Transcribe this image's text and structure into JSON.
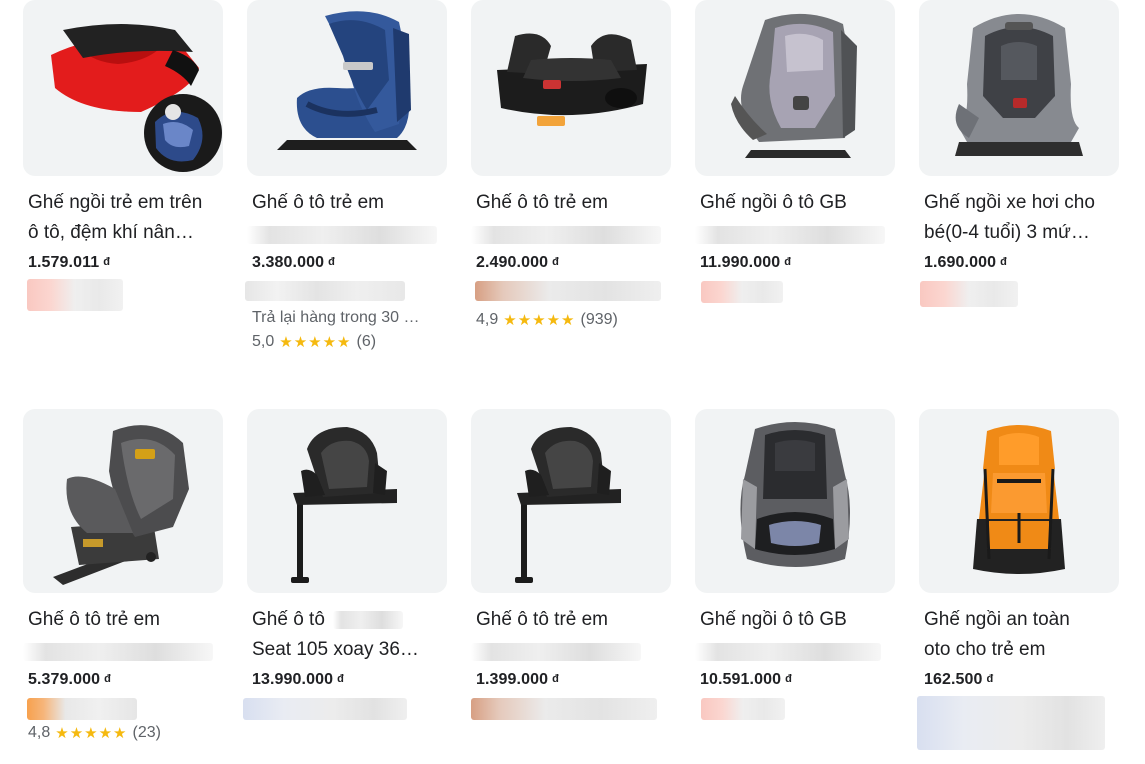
{
  "products": [
    {
      "title_l1": "Ghế ngồi trẻ em trên",
      "title_l2": "ô tô, đệm khí nân…",
      "price": "1.579.011",
      "currency": "đ",
      "extra": "",
      "rating": "",
      "review_count": "",
      "icon": "booster-cushion-image"
    },
    {
      "title_l1": "Ghế ô tô trẻ em",
      "title_l2": "",
      "price": "3.380.000",
      "currency": "đ",
      "extra": "Trả lại hàng trong 30 …",
      "rating": "5,0",
      "review_count": "(6)",
      "icon": "blue-car-seat-image"
    },
    {
      "title_l1": "Ghế ô tô trẻ em",
      "title_l2": "",
      "price": "2.490.000",
      "currency": "đ",
      "extra": "",
      "rating": "4,9",
      "review_count": "(939)",
      "icon": "black-booster-seat-image"
    },
    {
      "title_l1": "Ghế ngồi ô tô GB",
      "title_l2": "",
      "price": "11.990.000",
      "currency": "đ",
      "extra": "",
      "rating": "",
      "review_count": "",
      "icon": "gray-convertible-seat-image"
    },
    {
      "title_l1": "Ghế ngồi xe hơi cho",
      "title_l2": "bé(0-4 tuổi) 3 mứ…",
      "price": "1.690.000",
      "currency": "đ",
      "extra": "",
      "rating": "",
      "review_count": "",
      "icon": "gray-infant-seat-image"
    },
    {
      "title_l1": "Ghế ô tô trẻ em",
      "title_l2": "",
      "price": "5.379.000",
      "currency": "đ",
      "extra": "",
      "rating": "4,8",
      "review_count": "(23)",
      "icon": "rotating-isofix-seat-image"
    },
    {
      "title_l1": "Ghế ô tô",
      "title_l2": "Seat 105 xoay 36…",
      "price": "13.990.000",
      "currency": "đ",
      "extra": "",
      "rating": "",
      "review_count": "",
      "icon": "leg-support-seat-image"
    },
    {
      "title_l1": "Ghế ô tô trẻ em",
      "title_l2": "",
      "price": "1.399.000",
      "currency": "đ",
      "extra": "",
      "rating": "",
      "review_count": "",
      "icon": "leg-support-seat-image"
    },
    {
      "title_l1": "Ghế ngồi ô tô GB",
      "title_l2": "",
      "price": "10.591.000",
      "currency": "đ",
      "extra": "",
      "rating": "",
      "review_count": "",
      "icon": "high-back-booster-image"
    },
    {
      "title_l1": "Ghế ngồi an toàn",
      "title_l2": "oto cho trẻ em",
      "price": "162.500",
      "currency": "đ",
      "extra": "",
      "rating": "",
      "review_count": "",
      "icon": "orange-cushion-seat-image"
    }
  ],
  "stars": "★★★★★"
}
